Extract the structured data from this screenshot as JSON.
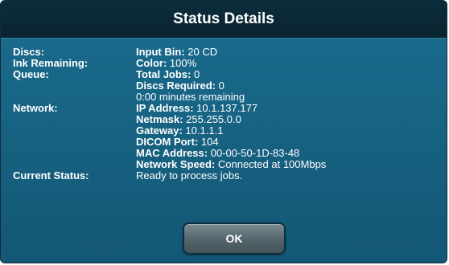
{
  "dialog": {
    "title": "Status Details",
    "ok_label": "OK"
  },
  "discs": {
    "label": "Discs:",
    "key": "Input Bin:",
    "value": "20 CD"
  },
  "ink": {
    "label": "Ink Remaining:",
    "key": "Color:",
    "value": "100%"
  },
  "queue": {
    "label": "Queue:",
    "total_jobs_key": "Total Jobs:",
    "total_jobs_value": "0",
    "discs_required_key": "Discs Required:",
    "discs_required_value": "0",
    "remaining": "0:00 minutes remaining"
  },
  "network": {
    "label": "Network:",
    "ip_key": "IP Address:",
    "ip_value": "10.1.137.177",
    "netmask_key": "Netmask:",
    "netmask_value": "255.255.0.0",
    "gateway_key": "Gateway:",
    "gateway_value": "10.1.1.1",
    "dicom_key": "DICOM Port:",
    "dicom_value": "104",
    "mac_key": "MAC Address:",
    "mac_value": "00-00-50-1D-83-48",
    "speed_key": "Network Speed:",
    "speed_value": "Connected at 100Mbps"
  },
  "current_status": {
    "label": "Current Status:",
    "value": "Ready to process jobs."
  }
}
